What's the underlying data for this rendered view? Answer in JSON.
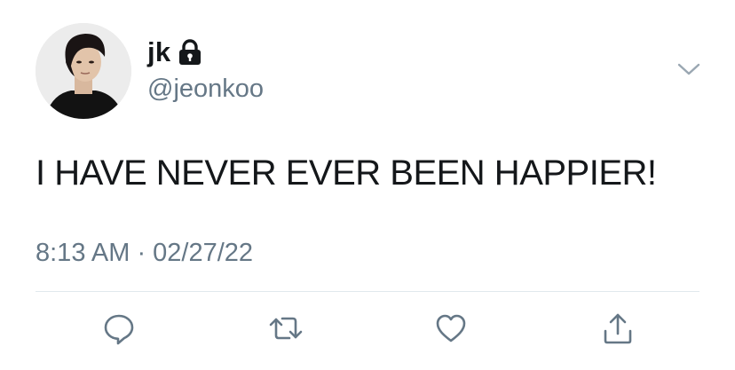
{
  "user": {
    "display_name": "jk",
    "handle": "@jeonkoo",
    "protected_icon": "lock-icon"
  },
  "tweet": {
    "text": "I HAVE NEVER EVER BEEN HAPPIER!",
    "timestamp": "8:13 AM · 02/27/22"
  },
  "actions": [
    {
      "name": "reply",
      "icon": "speech-bubble-icon"
    },
    {
      "name": "retweet",
      "icon": "retweet-icon"
    },
    {
      "name": "like",
      "icon": "heart-icon"
    },
    {
      "name": "share",
      "icon": "share-icon"
    }
  ],
  "menu_icon": "chevron-down-icon",
  "colors": {
    "text": "#14171a",
    "secondary": "#657786",
    "divider": "#e1e8ed",
    "icon": "#657786"
  }
}
